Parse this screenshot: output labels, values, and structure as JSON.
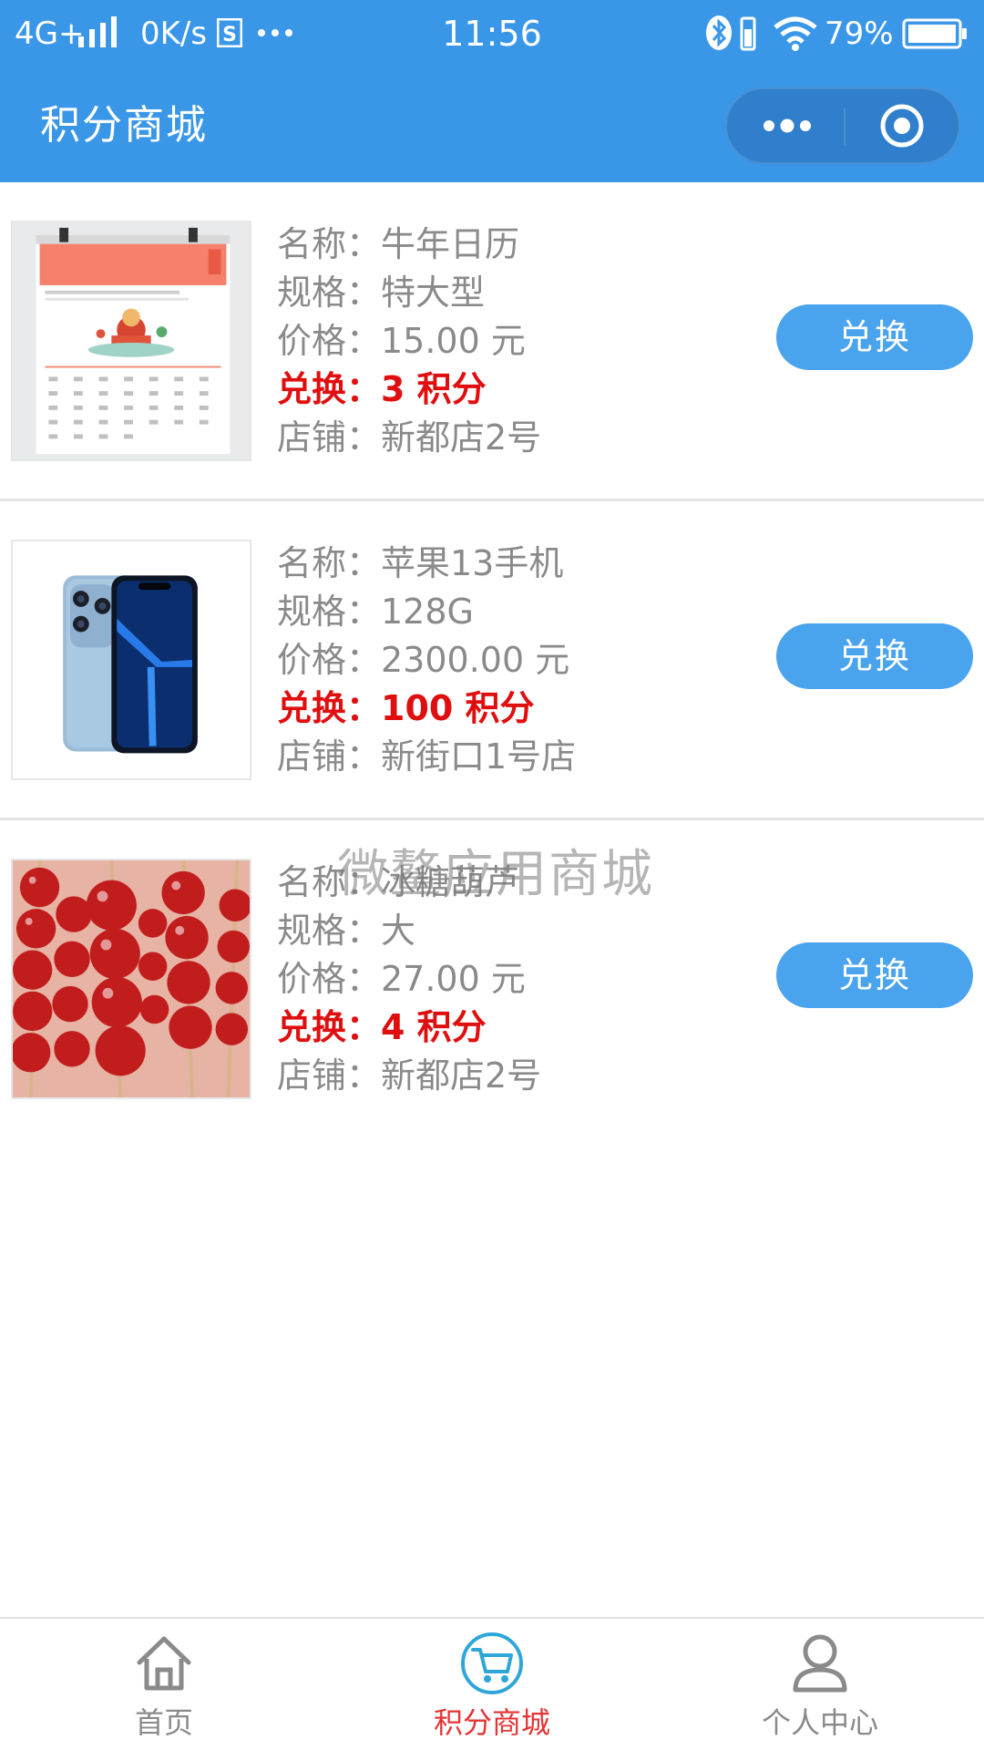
{
  "status_bar": {
    "network": "4G+",
    "speed": "0K/s",
    "time": "11:56",
    "battery": "79%"
  },
  "header": {
    "title": "积分商城"
  },
  "products": [
    {
      "name_line": "名称：牛年日历",
      "spec_line": "规格：特大型",
      "price_line": "价格：15.00 元",
      "points_line": "兑换：3 积分",
      "store_line": "店铺：新都店2号",
      "button_label": "兑换",
      "image": "calendar-image"
    },
    {
      "name_line": "名称：苹果13手机",
      "spec_line": "规格：128G",
      "price_line": "价格：2300.00 元",
      "points_line": "兑换：100 积分",
      "store_line": "店铺：新街口1号店",
      "button_label": "兑换",
      "image": "iphone-image"
    },
    {
      "name_line": "名称：冰糖葫芦",
      "spec_line": "规格：大",
      "price_line": "价格：27.00 元",
      "points_line": "兑换：4 积分",
      "store_line": "店铺：新都店2号",
      "button_label": "兑换",
      "image": "candied-hawthorn-image"
    }
  ],
  "watermark": "微鳌应用商城",
  "tab_bar": {
    "items": [
      {
        "label": "首页",
        "icon": "home-icon",
        "active": false
      },
      {
        "label": "积分商城",
        "icon": "cart-icon",
        "active": true
      },
      {
        "label": "个人中心",
        "icon": "user-icon",
        "active": false
      }
    ]
  },
  "colors": {
    "primary": "#3a97e8",
    "button": "#4aa3ed",
    "points_red": "#e00f0f",
    "active_tab": "#e53333",
    "text_gray": "#8a8a8a"
  }
}
